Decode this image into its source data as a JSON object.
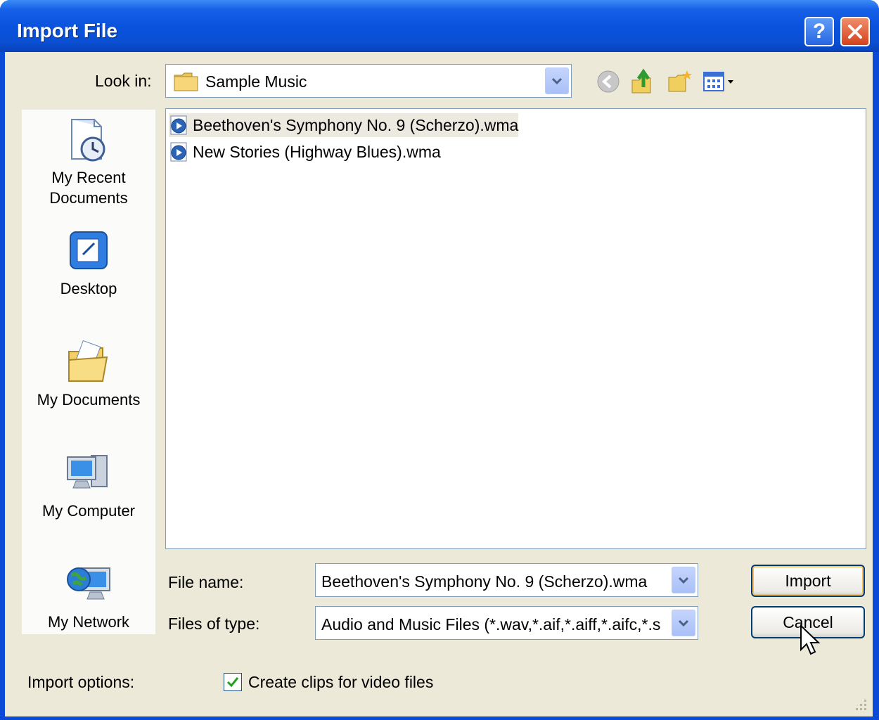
{
  "window": {
    "title": "Import File"
  },
  "title_buttons": {
    "help_label": "?"
  },
  "look_in": {
    "label": "Look in:",
    "value": "Sample Music"
  },
  "toolbar": {
    "icons": [
      "back-icon",
      "up-folder-icon",
      "new-folder-icon",
      "views-menu-icon"
    ]
  },
  "places": [
    {
      "label_line1": "My Recent",
      "label_line2": "Documents"
    },
    {
      "label_line1": "Desktop"
    },
    {
      "label_line1": "My Documents"
    },
    {
      "label_line1": "My Computer"
    },
    {
      "label_line1": "My Network"
    }
  ],
  "files": [
    {
      "name": "Beethoven's Symphony No. 9 (Scherzo).wma",
      "selected": true
    },
    {
      "name": "New Stories (Highway Blues).wma",
      "selected": false
    }
  ],
  "file_name": {
    "label": "File name:",
    "value": "Beethoven's Symphony No. 9 (Scherzo).wma"
  },
  "file_type": {
    "label": "Files of type:",
    "value": "Audio and Music Files (*.wav,*.aif,*.aiff,*.aifc,*.s"
  },
  "buttons": {
    "import": "Import",
    "cancel": "Cancel"
  },
  "import_options": {
    "label": "Import options:",
    "checkbox_label": "Create clips for video files",
    "checked": true
  },
  "colors": {
    "title_bar": "#0a4fd4",
    "dialog_bg": "#ece9d8",
    "button_border": "#003c74",
    "close_red": "#d4431c"
  }
}
